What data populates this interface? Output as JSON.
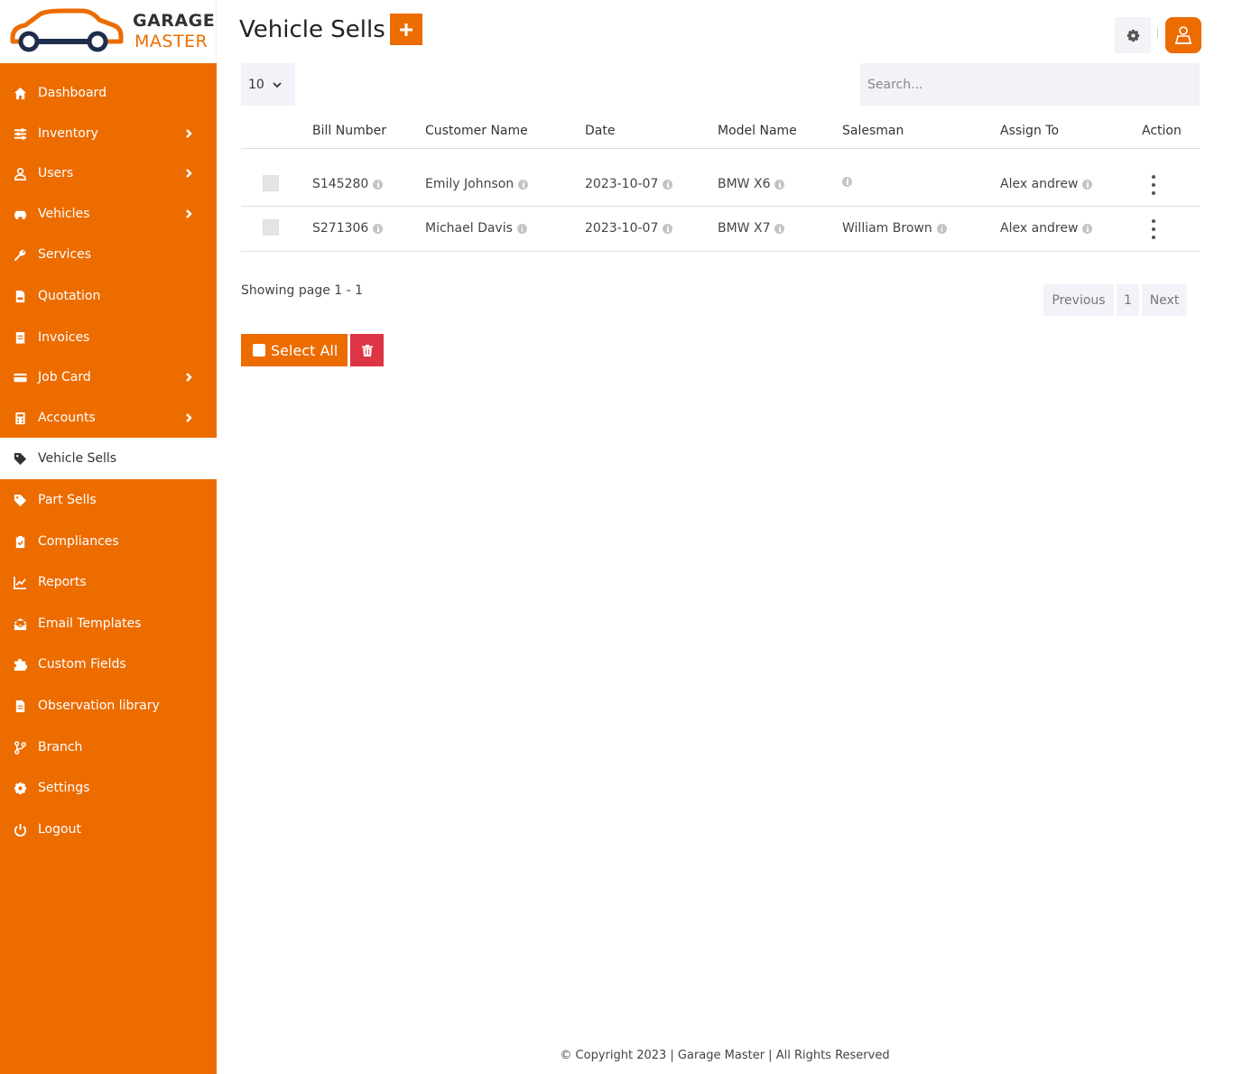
{
  "brand": {
    "line1": "GARAGE",
    "line2": "MASTER",
    "accent": "#EC6C00"
  },
  "sidebar": {
    "items": [
      {
        "label": "Dashboard",
        "icon": "home-icon",
        "has_submenu": false
      },
      {
        "label": "Inventory",
        "icon": "sliders-icon",
        "has_submenu": true
      },
      {
        "label": "Users",
        "icon": "user-icon",
        "has_submenu": true
      },
      {
        "label": "Vehicles",
        "icon": "car-icon",
        "has_submenu": true
      },
      {
        "label": "Services",
        "icon": "wrench-icon",
        "has_submenu": false
      },
      {
        "label": "Quotation",
        "icon": "file-invoice-icon",
        "has_submenu": false
      },
      {
        "label": "Invoices",
        "icon": "receipt-icon",
        "has_submenu": false
      },
      {
        "label": "Job Card",
        "icon": "credit-card-icon",
        "has_submenu": true
      },
      {
        "label": "Accounts",
        "icon": "calculator-icon",
        "has_submenu": true
      },
      {
        "label": "Vehicle Sells",
        "icon": "tag-icon",
        "has_submenu": false,
        "active": true
      },
      {
        "label": "Part Sells",
        "icon": "tag-icon",
        "has_submenu": false
      },
      {
        "label": "Compliances",
        "icon": "clipboard-check-icon",
        "has_submenu": false
      },
      {
        "label": "Reports",
        "icon": "chart-line-icon",
        "has_submenu": false
      },
      {
        "label": "Email Templates",
        "icon": "envelope-open-icon",
        "has_submenu": false
      },
      {
        "label": "Custom Fields",
        "icon": "puzzle-icon",
        "has_submenu": false
      },
      {
        "label": "Observation library",
        "icon": "file-text-icon",
        "has_submenu": false
      },
      {
        "label": "Branch",
        "icon": "code-branch-icon",
        "has_submenu": false
      },
      {
        "label": "Settings",
        "icon": "gear-icon",
        "has_submenu": false
      },
      {
        "label": "Logout",
        "icon": "power-icon",
        "has_submenu": false
      }
    ]
  },
  "header": {
    "title": "Vehicle Sells"
  },
  "table": {
    "page_length": "10",
    "search_placeholder": "Search...",
    "columns": [
      "Bill Number",
      "Customer Name",
      "Date",
      "Model Name",
      "Salesman",
      "Assign To",
      "Action"
    ],
    "rows": [
      {
        "bill": "S145280",
        "customer": "Emily Johnson",
        "date": "2023-10-07",
        "model": "BMW X6",
        "salesman": "",
        "assign": "Alex andrew"
      },
      {
        "bill": "S271306",
        "customer": "Michael Davis",
        "date": "2023-10-07",
        "model": "BMW X7",
        "salesman": "William Brown",
        "assign": "Alex andrew"
      }
    ],
    "showing": "Showing page 1 - 1",
    "pagination": {
      "previous": "Previous",
      "page": "1",
      "next": "Next"
    }
  },
  "bulk": {
    "select_all": "Select All"
  },
  "footer": {
    "text": "© Copyright 2023 | Garage Master | All Rights Reserved"
  }
}
